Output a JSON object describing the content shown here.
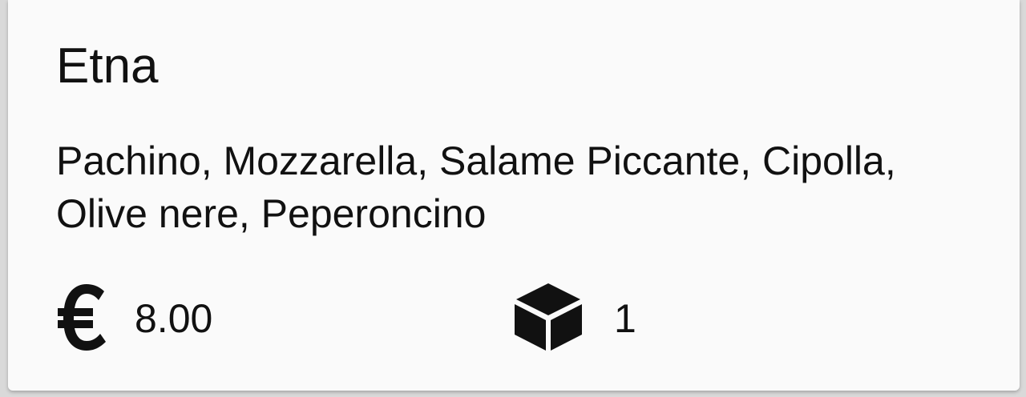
{
  "product": {
    "name": "Etna",
    "ingredients": "Pachino, Mozzarella, Salame Piccante, Cipolla, Olive nere, Peperoncino",
    "price": "8.00",
    "quantity": "1",
    "price_icon": "euro-icon",
    "quantity_icon": "cube-icon"
  },
  "colors": {
    "card_background": "#fafafa",
    "text": "#111111",
    "page_background": "#d9d9d9"
  }
}
